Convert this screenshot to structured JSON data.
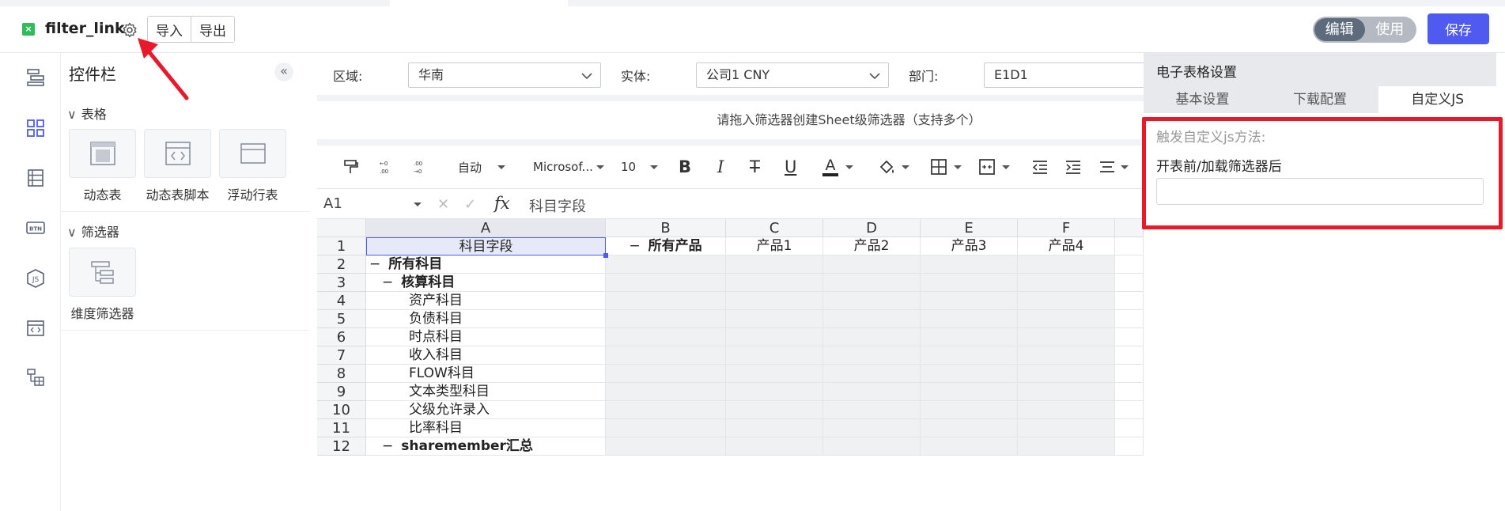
{
  "header": {
    "file_icon": "excel-file-icon",
    "title": "filter_link",
    "import_label": "导入",
    "export_label": "导出",
    "mode_edit": "编辑",
    "mode_use": "使用",
    "save_label": "保存"
  },
  "rail": {
    "icons": [
      "layout-icon",
      "grid-icon",
      "list-icon",
      "btn-icon",
      "js-icon",
      "code-window-icon",
      "tree-table-icon"
    ]
  },
  "control_panel": {
    "title": "控件栏",
    "sections": [
      {
        "label": "表格",
        "tiles": [
          "动态表",
          "动态表脚本",
          "浮动行表"
        ]
      },
      {
        "label": "筛选器",
        "tiles": [
          "维度筛选器"
        ]
      }
    ]
  },
  "filters": {
    "region_label": "区域:",
    "region_value": "华南",
    "entity_label": "实体:",
    "entity_value": "公司1 CNY",
    "dept_label": "部门:",
    "dept_value": "E1D1"
  },
  "drop_hint": "请拖入筛选器创建Sheet级筛选器（支持多个）",
  "toolbar": {
    "auto_label": "自动",
    "font_name": "Microsof...",
    "font_size": "10"
  },
  "formula_bar": {
    "cell_ref": "A1",
    "fx": "fx",
    "content": "科目字段"
  },
  "grid": {
    "columns": [
      "A",
      "B",
      "C",
      "D",
      "E",
      "F"
    ],
    "row_numbers": [
      "1",
      "2",
      "3",
      "4",
      "5",
      "6",
      "7",
      "8",
      "9",
      "10",
      "11",
      "12"
    ],
    "header_row": [
      "科目字段",
      "所有产品",
      "产品1",
      "产品2",
      "产品3",
      "产品4"
    ],
    "column_a": [
      "所有科目",
      "核算科目",
      "资产科目",
      "负债科目",
      "时点科目",
      "收入科目",
      "FLOW科目",
      "文本类型科目",
      "父级允许录入",
      "比率科目",
      "sharemember汇总"
    ],
    "collapse_symbol": "−"
  },
  "settings_panel": {
    "title": "电子表格设置",
    "tabs": [
      "基本设置",
      "下载配置",
      "自定义JS"
    ],
    "active_tab": 2,
    "trigger_label": "触发自定义js方法:",
    "field_label": "开表前/加载筛选器后",
    "field_value": ""
  },
  "colors": {
    "accent": "#4f5bf0",
    "annotation": "#e8192a",
    "toggle_active": "#5d6b7c"
  }
}
